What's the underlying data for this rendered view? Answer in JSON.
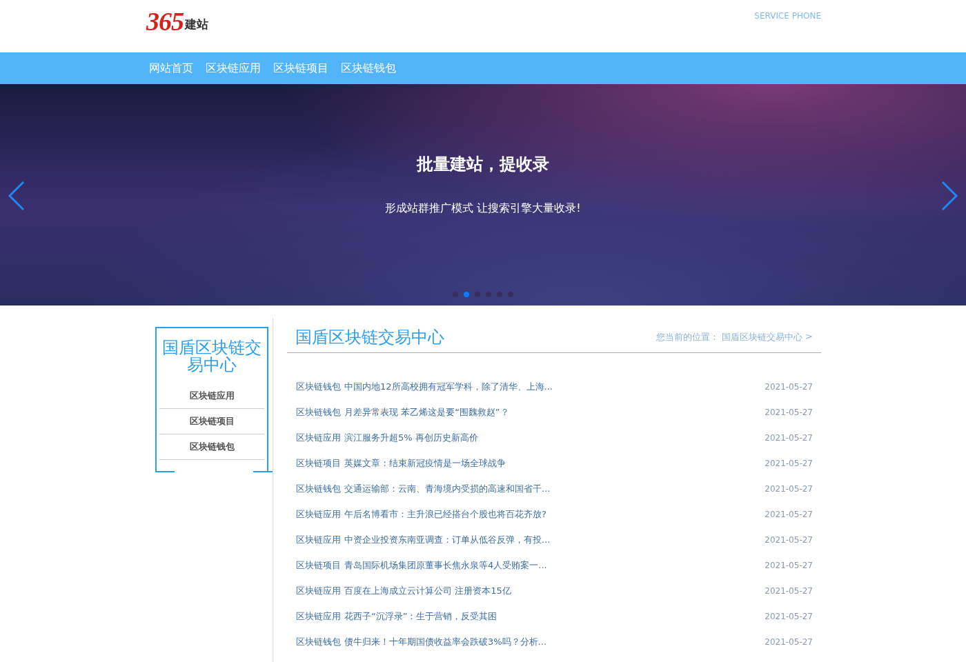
{
  "header": {
    "logo_number": "365",
    "logo_text": "建站",
    "service": "SERVICE PHONE"
  },
  "nav": [
    {
      "label": "网站首页"
    },
    {
      "label": "区块链应用"
    },
    {
      "label": "区块链项目"
    },
    {
      "label": "区块链钱包"
    }
  ],
  "banner": {
    "title": "批量建站，提收录",
    "subtitle": "形成站群推广模式 让搜索引擎大量收录!",
    "dots": [
      {
        "selected": false
      },
      {
        "selected": true
      },
      {
        "selected": false
      },
      {
        "selected": false
      },
      {
        "selected": false
      },
      {
        "selected": false
      }
    ]
  },
  "sidebar": {
    "title": "国盾区块链交易中心",
    "items": [
      {
        "label": "区块链应用"
      },
      {
        "label": "区块链项目"
      },
      {
        "label": "区块链钱包"
      }
    ]
  },
  "content": {
    "title": "国盾区块链交易中心",
    "breadcrumb_prefix": "您当前的位置：",
    "breadcrumb": "国盾区块链交易中心",
    "breadcrumb_sep": ">",
    "articles": [
      {
        "category": "区块链钱包",
        "title": "中国内地12所高校拥有冠军学科，除了清华、上海...",
        "date": "2021-05-27"
      },
      {
        "category": "区块链钱包",
        "title": "月差异常表现 苯乙烯这是要“围魏救赵”？",
        "date": "2021-05-27"
      },
      {
        "category": "区块链应用",
        "title": "滨江服务升超5% 再创历史新高价",
        "date": "2021-05-27"
      },
      {
        "category": "区块链项目",
        "title": "英媒文章：结束新冠疫情是一场全球战争",
        "date": "2021-05-27"
      },
      {
        "category": "区块链钱包",
        "title": "交通运输部：云南、青海境内受损的高速和国省干...",
        "date": "2021-05-27"
      },
      {
        "category": "区块链应用",
        "title": "午后名博看市：主升浪已经搭台个股也将百花齐放?",
        "date": "2021-05-27"
      },
      {
        "category": "区块链应用",
        "title": "中资企业投资东南亚调查：订单从低谷反弹，有投...",
        "date": "2021-05-27"
      },
      {
        "category": "区块链项目",
        "title": "青岛国际机场集团原董事长焦永泉等4人受贿案一...",
        "date": "2021-05-27"
      },
      {
        "category": "区块链应用",
        "title": "百度在上海成立云计算公司 注册资本15亿",
        "date": "2021-05-27"
      },
      {
        "category": "区块链应用",
        "title": "花西子“沉浮录”：生于营销，反受其困",
        "date": "2021-05-27"
      },
      {
        "category": "区块链钱包",
        "title": "债牛归来！十年期国债收益率会跌破3%吗？分析...",
        "date": "2021-05-27"
      }
    ]
  }
}
